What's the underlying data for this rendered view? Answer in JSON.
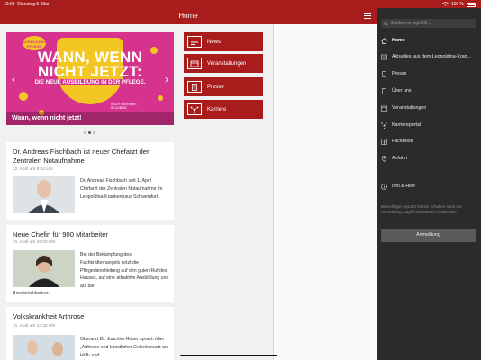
{
  "status": {
    "time": "10:06",
    "date": "Dienstag 5. Mai",
    "battery": "100 %"
  },
  "appbar": {
    "title": "Home"
  },
  "hero": {
    "headline": "WANN, WENN NICHT JETZT:",
    "sub": "DIE NEUE AUSBILDUNG IN DER PFLEGE.",
    "caption": "Wann, wenn nicht jetzt!",
    "sticker": "AUSBILDUNG PFLEGE",
    "logo": "NACH KARRIERE IN LEIBNIZ"
  },
  "tiles": [
    {
      "label": "News",
      "icon": "news-icon"
    },
    {
      "label": "Veranstaltungen",
      "icon": "calendar-icon"
    },
    {
      "label": "Presse",
      "icon": "document-icon"
    },
    {
      "label": "Karriere",
      "icon": "network-icon"
    }
  ],
  "articles": [
    {
      "title": "Dr. Andreas Fischbach ist neuer Chefarzt der Zentralen Notaufnahme",
      "date": "22. April um 8:44 Uhr",
      "text": "Dr. Andreas Fischbach seit 1. April Chefarzt der Zentralen Notaufnahme im Leopoldina-Krankenhaus Schweinfurt."
    },
    {
      "title": "Neue Chefin für 900 Mitarbeiter",
      "date": "21. April um 15:03 Uhr",
      "text": "Bei der Bekämpfung des Fachkräftemangels setzt die Pflegedienstleitung auf den guten Ruf des Hauses, auf eine attraktive Ausbildung und auf die",
      "text_cont": "Berufsrückkehrer."
    },
    {
      "title": "Volkskrankheit Arthrose",
      "date": "21. April um 13:32 Uhr",
      "text": "Oberarzt Dr. Joachim Hüber sprach über „Arthrose und künstlicher Gelenkersatz an Hüft- und"
    }
  ],
  "drawer": {
    "search_placeholder": "Suchen in myLEO...",
    "items": [
      {
        "label": "Home",
        "icon": "home-icon"
      },
      {
        "label": "Aktuelles aus dem Leopoldina-Kran...",
        "icon": "news-icon"
      },
      {
        "label": "Presse",
        "icon": "document-icon"
      },
      {
        "label": "Über uns",
        "icon": "document-icon"
      },
      {
        "label": "Veranstaltungen",
        "icon": "calendar-icon"
      },
      {
        "label": "Karriereportal",
        "icon": "network-icon"
      },
      {
        "label": "Facebook",
        "icon": "facebook-icon"
      },
      {
        "label": "Anfahrt",
        "icon": "location-icon"
      }
    ],
    "help": "Info & Hilfe",
    "info": "Berechtigte myLEO-Nutzer erhalten nach der Anmeldung Zugriff auf weitere Funktionen",
    "login": "Anmeldung"
  }
}
